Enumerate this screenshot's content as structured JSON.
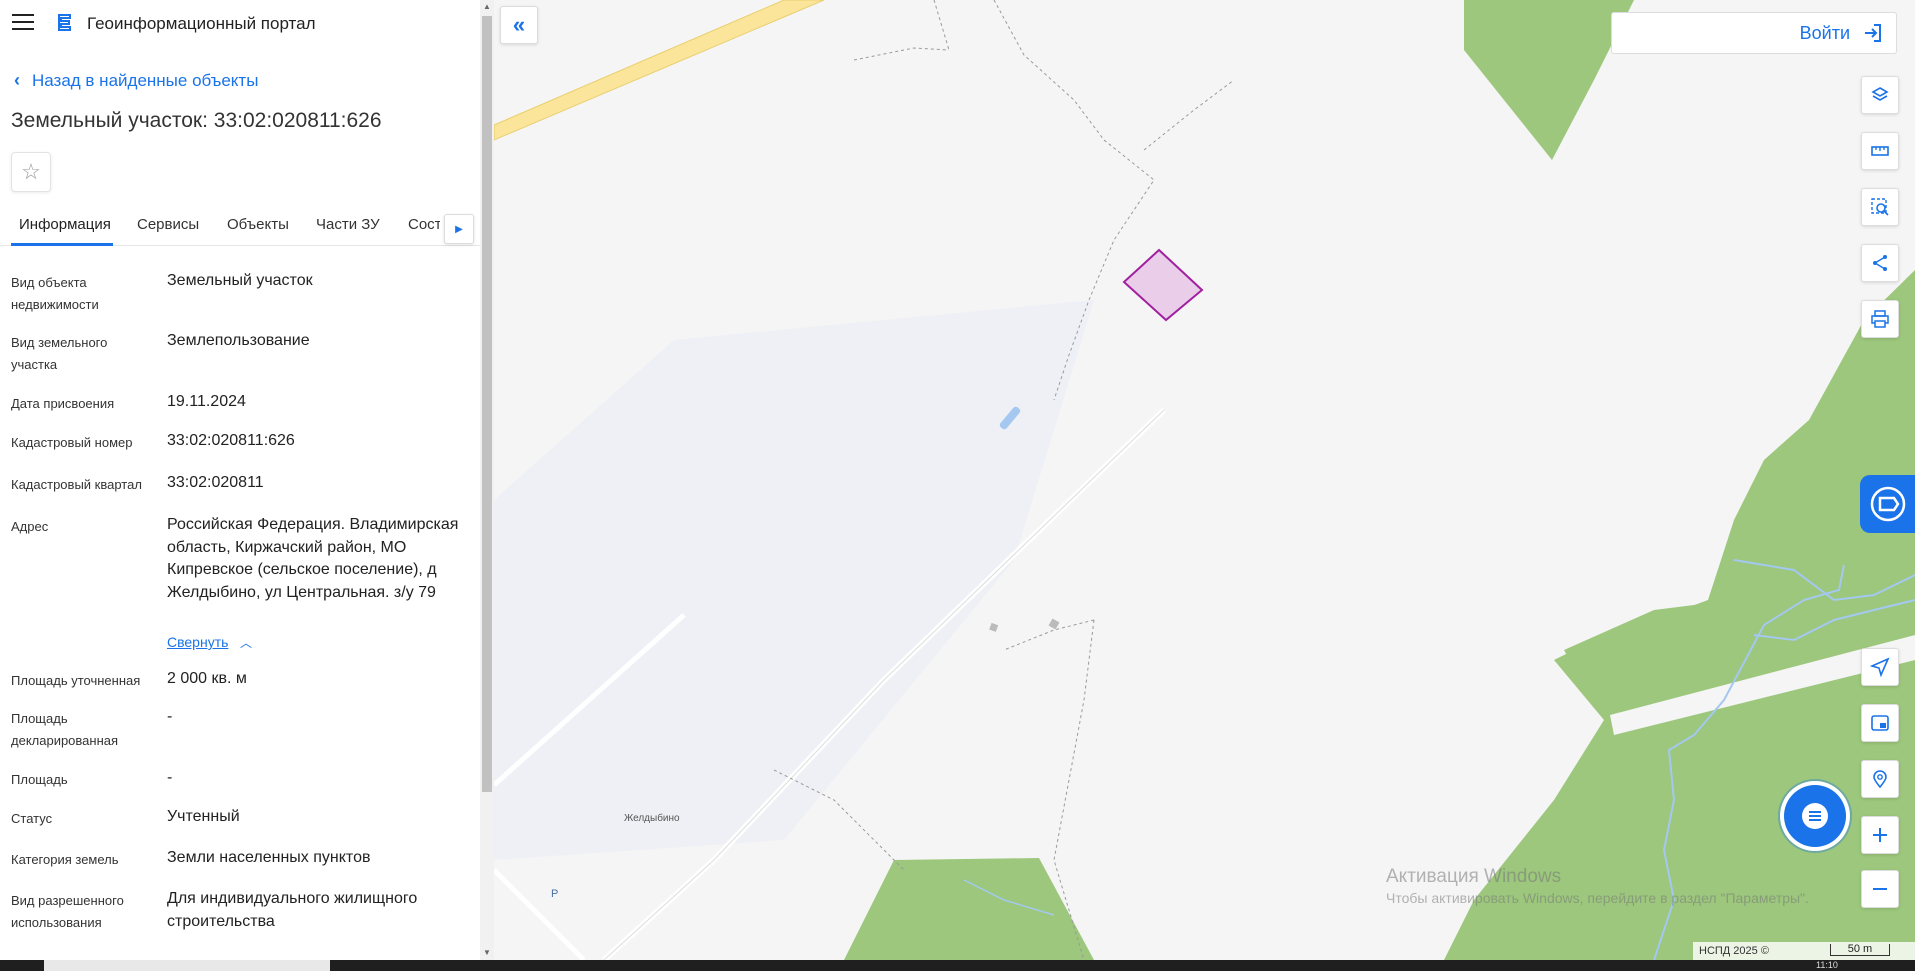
{
  "header": {
    "portal_title": "Геоинформационный портал",
    "back_link": "Назад в найденные объекты",
    "object_title": "Земельный участок: 33:02:020811:626"
  },
  "tabs": [
    {
      "label": "Информация",
      "active": true
    },
    {
      "label": "Сервисы"
    },
    {
      "label": "Объекты"
    },
    {
      "label": "Части ЗУ"
    },
    {
      "label": "Состав ЕЗ"
    }
  ],
  "info": {
    "object_type": {
      "label": "Вид объекта недвижимости",
      "value": "Земельный участок"
    },
    "parcel_type": {
      "label": "Вид земельного участка",
      "value": "Землепользование"
    },
    "assign_date": {
      "label": "Дата присвоения",
      "value": "19.11.2024"
    },
    "cadastral_number": {
      "label": "Кадастровый номер",
      "value": "33:02:020811:626"
    },
    "cadastral_block": {
      "label": "Кадастровый квартал",
      "value": "33:02:020811"
    },
    "address": {
      "label": "Адрес",
      "value": "Российская Федерация. Владимирская область, Киржачский район, МО Кипревское (сельское поселение), д Желдыбино, ул Центральная. з/у 79",
      "collapse": "Свернуть"
    },
    "area_specified": {
      "label": "Площадь уточненная",
      "value": "2 000 кв. м"
    },
    "area_declared": {
      "label": "Площадь декларированная",
      "value": "-"
    },
    "area": {
      "label": "Площадь",
      "value": "-"
    },
    "status": {
      "label": "Статус",
      "value": "Учтенный"
    },
    "land_category": {
      "label": "Категория земель",
      "value": "Земли населенных пунктов"
    },
    "permitted_use": {
      "label": "Вид разрешенного использования",
      "value": "Для индивидуального жилищного строительства"
    }
  },
  "map": {
    "login_label": "Войти",
    "village_label": "Желдыбино",
    "parking_label": "P",
    "watermark_title": "Активация Windows",
    "watermark_sub": "Чтобы активировать Windows, перейдите в раздел \"Параметры\".",
    "attribution": "НСПД 2025 ©",
    "scale_label": "50 m",
    "colors": {
      "forest": "#9cc77c",
      "road": "#fbe59a",
      "parcel_fill": "#e6c6e6",
      "parcel_stroke": "#a020a0",
      "accent": "#1a73e8",
      "water": "#a4c8f0"
    }
  },
  "taskbar": {
    "clock": "11:10"
  }
}
